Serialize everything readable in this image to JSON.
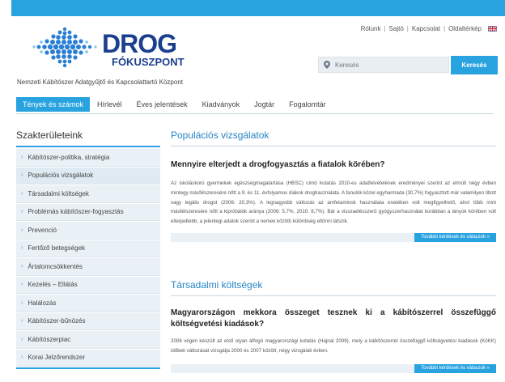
{
  "header": {
    "logo_line1": "DROG",
    "logo_line2": "FÓKUSZPONT",
    "top_links": [
      "Rólunk",
      "Sajtó",
      "Kapcsolat",
      "Oldaltérkép"
    ],
    "search_placeholder": "Keresés",
    "search_button": "Keresés",
    "tagline": "Nemzeti Kábítószer Adatgyűjtő és Kapcsolattartó Központ"
  },
  "nav": {
    "items": [
      {
        "label": "Tények és számok",
        "active": true
      },
      {
        "label": "Hírlevél",
        "active": false
      },
      {
        "label": "Éves jelentések",
        "active": false
      },
      {
        "label": "Kiadványok",
        "active": false
      },
      {
        "label": "Jogtár",
        "active": false
      },
      {
        "label": "Fogalomtár",
        "active": false
      }
    ]
  },
  "sidebar": {
    "title": "Szakterületeink",
    "items": [
      "Kábítószer-politika, stratégia",
      "Populációs vizsgálatok",
      "Társadalmi költségek",
      "Problémás kábítószer-fogyasztás",
      "Prevenció",
      "Fertőző betegségek",
      "Ártalomcsökkentés",
      "Kezelés – Ellátás",
      "Halálozás",
      "Kábítószer-bűnözés",
      "Kábítószerpiac",
      "Korai Jelzőrendszer"
    ]
  },
  "main": {
    "sections": [
      {
        "title": "Populációs vizsgálatok",
        "question": "Mennyire elterjedt a drogfogyasztás a fiatalok körében?",
        "body": "Az iskoláskorú gyermekek egészségmagatartása (HBSC) című kutatás 2010-es adatfelvételének eredményei szerint az elmúlt négy évben mintegy másfélszeresére nőtt a 9. és 11. évfolyamos diákok droghasználata. A fanulók közel egyharmada (30,7%) fogyasztott már valamilyen tiltott vagy legális drogot (2006: 20,3%). A legnagyobb változás az amfetaminok használata esetében volt megfigyelhető, ahol több mint másfélszeresére nőtt a kipróbálók aránya (2006: 5,7%, 2010: 8,7%). Bár a visszaélésszerű gyógyszerhasználat korábban a lányok körében volt elterjedtebb, a jelenlegi adatok szerint a nemek közötti különbség eltűnni látszik.",
        "more": "További kérdések és válaszok »"
      },
      {
        "title": "Társadalmi költségek",
        "question": "Magyarországon mekkora összeget tesznek ki a kábítószerrel összefüggő költségvetési kiadások?",
        "body": "2008 végén készült az első olyan átfogó magyarországi kutatás (Hajnal 2009), mely a kábítószerrel összefüggő költségvetési kiadások (KöKK) időbeli változását vizsgálja 2000 és 2007 között, négy vizsgálati évben.",
        "more": "További kérdések és válaszok »"
      }
    ]
  },
  "colors": {
    "accent": "#29a3e0",
    "brand": "#1b3f8f",
    "section_title": "#2585c4"
  }
}
